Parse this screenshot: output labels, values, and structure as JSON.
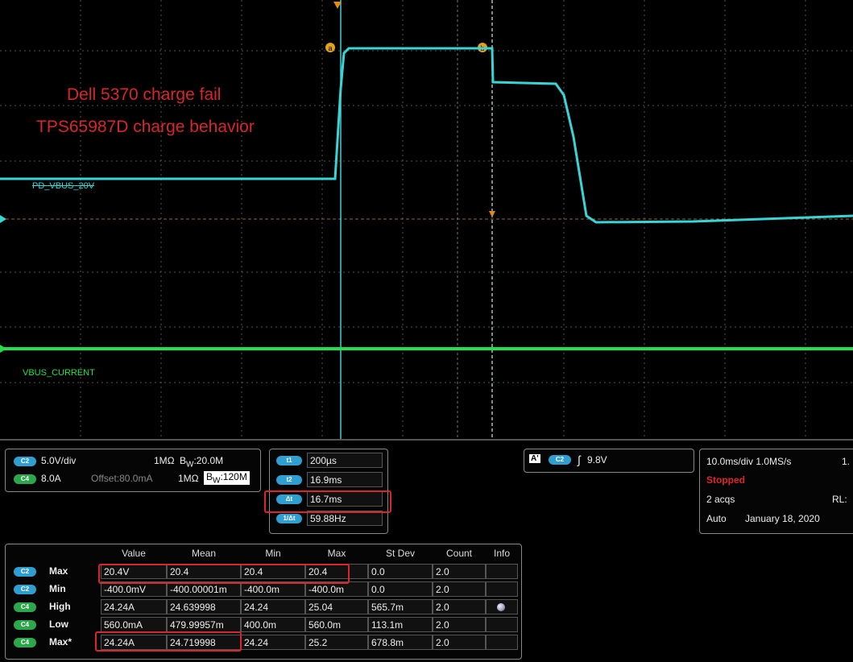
{
  "annotation": {
    "line1": "Dell 5370 charge fail",
    "line2": "TPS65987D  charge behavior"
  },
  "traces": {
    "c2_label": "PD_VBUS_20V",
    "c4_label": "VBUS_CURRENT",
    "c2_color": "#38d4d6",
    "c4_color": "#22e04a",
    "cursor_a": "a",
    "cursor_b": "b"
  },
  "channel_settings": {
    "c2": {
      "badge": "C2",
      "scale": "5.0V/div",
      "impedance": "1MΩ",
      "bw_prefix": "B",
      "bw_sub": "W",
      "bw": ":20.0M"
    },
    "c4": {
      "badge": "C4",
      "scale": "8.0A",
      "offset": "Offset:80.0mA",
      "impedance": "1MΩ",
      "bw_prefix": "B",
      "bw_sub": "W",
      "bw": ":120M"
    }
  },
  "cursors": [
    {
      "badge": "t1",
      "value": "200µs"
    },
    {
      "badge": "t2",
      "value": "16.9ms"
    },
    {
      "badge": "Δt",
      "value": "16.7ms"
    },
    {
      "badge": "1/Δt",
      "value": "59.88Hz"
    }
  ],
  "trigger": {
    "badge_a": "A'",
    "badge_ch": "C2",
    "level": "9.8V"
  },
  "acquisition": {
    "timebase": "10.0ms/div 1.0MS/s",
    "extra": "1.",
    "state": "Stopped",
    "acqs": "2 acqs",
    "rl": "RL:",
    "mode": "Auto",
    "date": "January 18, 2020"
  },
  "measurements": {
    "headers": [
      "Value",
      "Mean",
      "Min",
      "Max",
      "St Dev",
      "Count",
      "Info"
    ],
    "rows": [
      {
        "badge": "C2",
        "label": "Max",
        "cells": [
          "20.4V",
          "20.4",
          "20.4",
          "20.4",
          "0.0",
          "2.0",
          ""
        ]
      },
      {
        "badge": "C2",
        "label": "Min",
        "cells": [
          "-400.0mV",
          "-400.00001m",
          "-400.0m",
          "-400.0m",
          "0.0",
          "2.0",
          ""
        ]
      },
      {
        "badge": "C4",
        "label": "High",
        "cells": [
          "24.24A",
          "24.639998",
          "24.24",
          "25.04",
          "565.7m",
          "2.0",
          ""
        ]
      },
      {
        "badge": "C4",
        "label": "Low",
        "cells": [
          "560.0mA",
          "479.99957m",
          "400.0m",
          "560.0m",
          "113.1m",
          "2.0",
          ""
        ]
      },
      {
        "badge": "C4",
        "label": "Max*",
        "cells": [
          "24.24A",
          "24.719998",
          "24.24",
          "25.2",
          "678.8m",
          "2.0",
          ""
        ]
      }
    ]
  }
}
